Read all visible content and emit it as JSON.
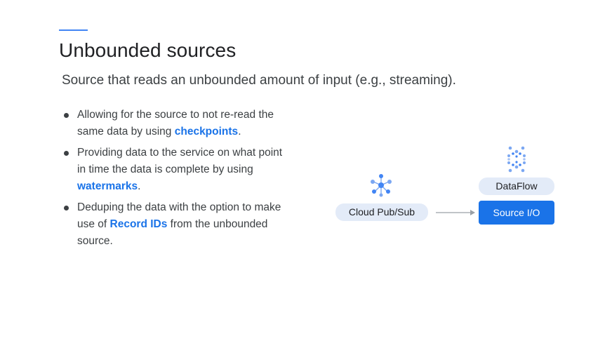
{
  "slide": {
    "title": "Unbounded sources",
    "subtitle": "Source that reads an unbounded amount of input (e.g., streaming)."
  },
  "bullets": [
    {
      "before": "Allowing for the source to not re-read the same data by using ",
      "highlight": "checkpoints",
      "after": "."
    },
    {
      "before": "Providing data to the service on what point in time the data is complete by using ",
      "highlight": "watermarks",
      "after": "."
    },
    {
      "before": "Deduping the data with the option to make use of ",
      "highlight": "Record IDs",
      "after": " from the unbounded source."
    }
  ],
  "diagram": {
    "pubsub_label": "Cloud Pub/Sub",
    "dataflow_label": "DataFlow",
    "source_io_label": "Source I/O",
    "pubsub_icon": "pubsub-icon",
    "dataflow_icon": "dataflow-icon",
    "colors": {
      "accent": "#1a73e8",
      "pill_light": "#e3ebf8",
      "icon_blue": "#4285f4"
    }
  }
}
